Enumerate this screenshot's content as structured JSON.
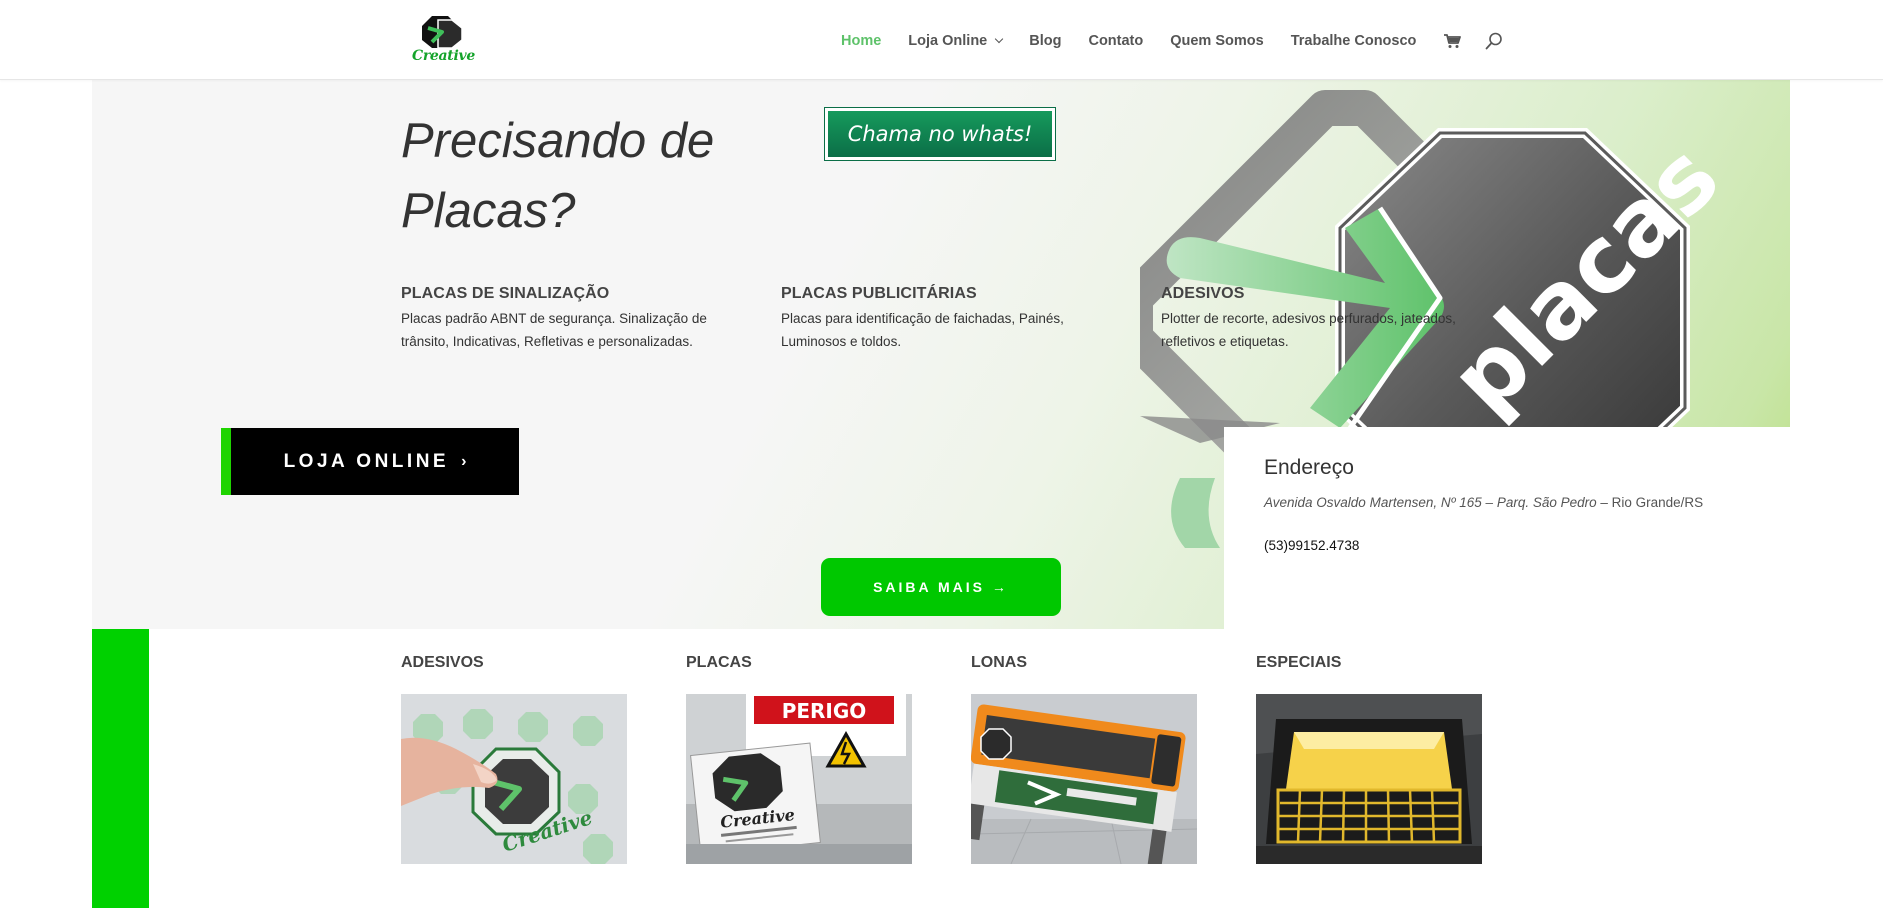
{
  "header": {
    "logo_text": "Creative",
    "nav": [
      {
        "label": "Home",
        "active": true
      },
      {
        "label": "Loja Online",
        "has_dropdown": true
      },
      {
        "label": "Blog"
      },
      {
        "label": "Contato"
      },
      {
        "label": "Quem Somos"
      },
      {
        "label": "Trabalhe Conosco"
      }
    ],
    "icons": [
      "cart-icon",
      "search-icon"
    ]
  },
  "hero": {
    "title_line1": "Precisando de",
    "title_line2": "Placas?",
    "whats_button": "Chama no whats!",
    "graphic_text": "placas",
    "features": [
      {
        "title": "PLACAS DE SINALIZAÇÃO",
        "text_line1": "Placas padrão ABNT de segurança. Sinalização de",
        "text_line2": "trânsito, Indicativas, Refletivas e personalizadas."
      },
      {
        "title": "PLACAS PUBLICITÁRIAS",
        "text_line1": "Placas para identificação de faichadas, Painés,",
        "text_line2": "Luminosos e toldos."
      },
      {
        "title": "ADESIVOS",
        "text_line1": "Plotter de recorte, adesivos perfurados, jateados,",
        "text_line2": "refletivos e etiquetas."
      }
    ],
    "loja_button": "LOJA ONLINE",
    "loja_arrow": "›",
    "saiba_button": "SAIBA MAIS →"
  },
  "address": {
    "title": "Endereço",
    "street": "Avenida Osvaldo Martensen, Nº 165 – Parq. São Pedro",
    "city": " – Rio Grande/RS",
    "phone": "(53)99152.4738"
  },
  "categories": [
    {
      "title": "ADESIVOS"
    },
    {
      "title": "PLACAS",
      "sign_text": "PERIGO",
      "card_text": "Creative"
    },
    {
      "title": "LONAS"
    },
    {
      "title": "ESPECIAIS"
    }
  ],
  "colors": {
    "accent_green": "#00c800",
    "nav_active": "#5ec26a",
    "whats_green": "#0b6e47",
    "bar_green": "#00d100"
  }
}
